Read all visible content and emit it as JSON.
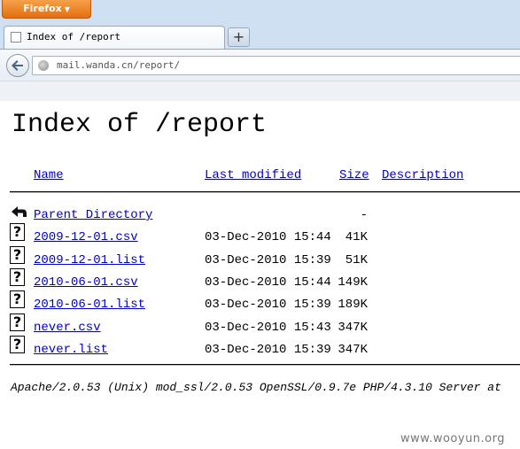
{
  "browser": {
    "menu_button_label": "Firefox",
    "tab_title": "Index of /report",
    "new_tab_label": "+",
    "url_host": "mail.wanda.cn",
    "url_path": "/report/",
    "icons": [
      "back-arrow-icon",
      "globe-icon",
      "favicon-blank-icon",
      "new-tab-icon"
    ]
  },
  "page": {
    "title": "Index of /report",
    "headers": {
      "name": "Name",
      "last_modified": "Last modified",
      "size": "Size",
      "description": "Description"
    },
    "entries": [
      {
        "name": "Parent Directory",
        "date": "",
        "size": "-",
        "icon": "back-folder-icon"
      },
      {
        "name": "2009-12-01.csv",
        "date": "03-Dec-2010 15:44",
        "size": "41K",
        "icon": "unknown-file-icon"
      },
      {
        "name": "2009-12-01.list",
        "date": "03-Dec-2010 15:39",
        "size": "51K",
        "icon": "unknown-file-icon"
      },
      {
        "name": "2010-06-01.csv",
        "date": "03-Dec-2010 15:44",
        "size": "149K",
        "icon": "unknown-file-icon"
      },
      {
        "name": "2010-06-01.list",
        "date": "03-Dec-2010 15:39",
        "size": "189K",
        "icon": "unknown-file-icon"
      },
      {
        "name": "never.csv",
        "date": "03-Dec-2010 15:43",
        "size": "347K",
        "icon": "unknown-file-icon"
      },
      {
        "name": "never.list",
        "date": "03-Dec-2010 15:39",
        "size": "347K",
        "icon": "unknown-file-icon"
      }
    ],
    "footer": "Apache/2.0.53 (Unix) mod_ssl/2.0.53 OpenSSL/0.9.7e PHP/4.3.10 Server at"
  },
  "watermark": "www.wooyun.org",
  "colors": {
    "link": "#0000cc",
    "firefox_button": "#e8781d",
    "chrome_bg": "#cfe0f3"
  }
}
